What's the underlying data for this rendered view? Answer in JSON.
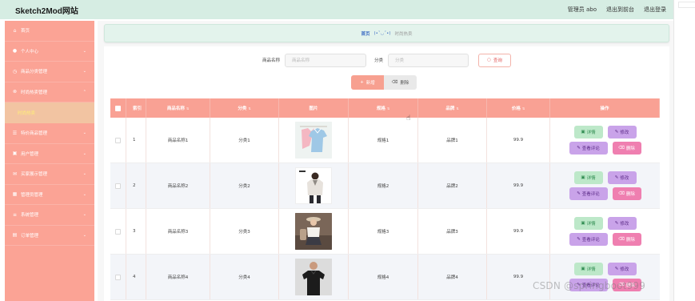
{
  "header": {
    "brand": "Sketch2Mod网站",
    "admin": "管理员 abo",
    "back_front": "退出到前台",
    "logout": "退出登录"
  },
  "sidebar": {
    "items": [
      {
        "label": "首页",
        "icon": "home-icon",
        "glyph": "⌂"
      },
      {
        "label": "个人中心",
        "icon": "user-icon",
        "glyph": "●"
      },
      {
        "label": "商品分类管理",
        "icon": "clock-icon",
        "glyph": "◷"
      },
      {
        "label": "时尚热卖管理",
        "icon": "circle-icon",
        "glyph": "⊗"
      },
      {
        "label": "时尚热卖",
        "sub": true
      },
      {
        "label": "特价商品管理",
        "icon": "list-icon",
        "glyph": "☰"
      },
      {
        "label": "用户管理",
        "icon": "user-box-icon",
        "glyph": "▣"
      },
      {
        "label": "买家展示管理",
        "icon": "mail-icon",
        "glyph": "✉"
      },
      {
        "label": "管理员管理",
        "icon": "grid-icon",
        "glyph": "▦"
      },
      {
        "label": "系统管理",
        "icon": "menu-icon",
        "glyph": "≡"
      },
      {
        "label": "订单管理",
        "icon": "card-icon",
        "glyph": "▤"
      }
    ]
  },
  "breadcrumb": {
    "home": "首页",
    "face": "(•ˇ◡ˇ•)",
    "current": "时尚热卖"
  },
  "search": {
    "name_label": "商品名称",
    "name_placeholder": "商品名称",
    "category_label": "分类",
    "category_placeholder": "分类",
    "query_button": "查询"
  },
  "toolbar": {
    "add_label": "新增",
    "delete_label": "删除"
  },
  "table": {
    "headers": {
      "index": "索引",
      "name": "商品名称",
      "category": "分类",
      "image": "图片",
      "spec": "规格",
      "brand": "品牌",
      "price": "价格",
      "ops": "操作"
    },
    "rows": [
      {
        "index": "1",
        "name": "商品名称1",
        "category": "分类1",
        "spec": "规格1",
        "brand": "品牌1",
        "price": "99.9"
      },
      {
        "index": "2",
        "name": "商品名称2",
        "category": "分类2",
        "spec": "规格2",
        "brand": "品牌2",
        "price": "99.9"
      },
      {
        "index": "3",
        "name": "商品名称3",
        "category": "分类3",
        "spec": "规格3",
        "brand": "品牌3",
        "price": "99.9"
      },
      {
        "index": "4",
        "name": "商品名称4",
        "category": "分类4",
        "spec": "规格4",
        "brand": "品牌4",
        "price": "99.9"
      }
    ],
    "op_labels": {
      "detail": "详情",
      "edit": "修改",
      "review": "查看评论",
      "remove": "删除"
    }
  },
  "watermark": "CSDN @springboot999",
  "colors": {
    "topbar": "#d6ede3",
    "sidebar": "#fba395",
    "header_row": "#f9a194",
    "detail_btn": "#bde8c9",
    "edit_btn": "#c9a3e9",
    "delete_btn": "#ef7fb0"
  }
}
